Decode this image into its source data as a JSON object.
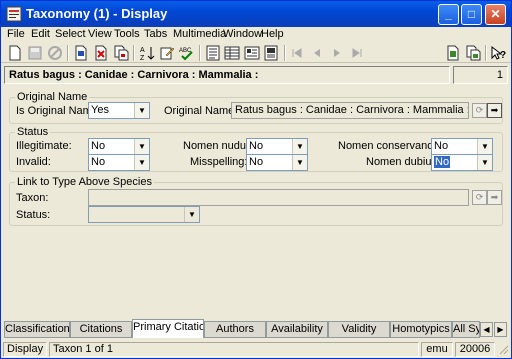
{
  "window": {
    "title": "Taxonomy (1) - Display",
    "minimize": "_",
    "maximize": "□",
    "close": "✕"
  },
  "menu": [
    "File",
    "Edit",
    "Select",
    "View",
    "Tools",
    "Tabs",
    "Multimedia",
    "Window",
    "Help"
  ],
  "header": {
    "record_name": "Ratus bagus : Canidae : Carnivora : Mammalia :",
    "record_number": "1"
  },
  "original_name": {
    "group_title": "Original Name",
    "is_original_label": "Is Original Name?",
    "is_original_value": "Yes",
    "original_name_is_label": "Original Name Is:",
    "original_name_is_value": "Ratus bagus : Canidae : Carnivora : Mammalia :"
  },
  "status": {
    "group_title": "Status",
    "illegitimate_label": "Illegitimate:",
    "illegitimate_value": "No",
    "invalid_label": "Invalid:",
    "invalid_value": "No",
    "nomen_nudum_label": "Nomen nudum:",
    "nomen_nudum_value": "No",
    "misspelling_label": "Misspelling:",
    "misspelling_value": "No",
    "nomen_conservandum_label": "Nomen conservandum:",
    "nomen_conservandum_value": "No",
    "nomen_dubium_label": "Nomen dubium:",
    "nomen_dubium_value": "No"
  },
  "link_type": {
    "group_title": "Link to Type Above Species",
    "taxon_label": "Taxon:",
    "taxon_value": "",
    "status_label": "Status:",
    "status_value": ""
  },
  "tabs": [
    "Classification",
    "Citations",
    "Primary Citation",
    "Authors",
    "Availability",
    "Validity",
    "Homotypics",
    "All Sy"
  ],
  "active_tab": "Primary Citation",
  "statusbar": {
    "mode": "Display",
    "position": "Taxon 1 of 1",
    "user": "emu",
    "count": "20006"
  },
  "colors": {
    "titlebar": "#0046d5",
    "window_bg": "#ece9d8",
    "selection": "#316ac5"
  }
}
